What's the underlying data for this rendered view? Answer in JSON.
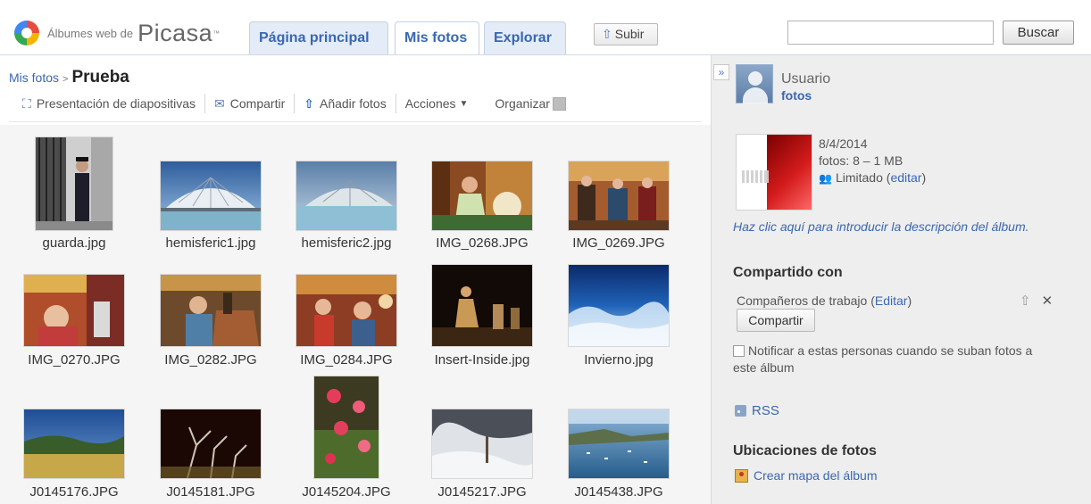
{
  "header": {
    "logo_sub": "Álbumes web de",
    "logo_main": "Picasa",
    "logo_tm": "™",
    "tabs": [
      {
        "label": "Página principal",
        "active": false
      },
      {
        "label": "Mis fotos",
        "active": true
      },
      {
        "label": "Explorar",
        "active": false
      }
    ],
    "upload_label": "Subir",
    "search_value": "",
    "search_button": "Buscar"
  },
  "breadcrumb": {
    "parent": "Mis fotos",
    "separator": ">",
    "current": "Prueba"
  },
  "toolbar": {
    "slideshow": "Presentación de diapositivas",
    "share": "Compartir",
    "add_photos": "Añadir fotos",
    "actions": "Acciones",
    "organize": "Organizar"
  },
  "photos": [
    {
      "name": "guarda.jpg"
    },
    {
      "name": "hemisferic1.jpg"
    },
    {
      "name": "hemisferic2.jpg"
    },
    {
      "name": "IMG_0268.JPG"
    },
    {
      "name": "IMG_0269.JPG"
    },
    {
      "name": "IMG_0270.JPG"
    },
    {
      "name": "IMG_0282.JPG"
    },
    {
      "name": "IMG_0284.JPG"
    },
    {
      "name": "Insert-Inside.jpg"
    },
    {
      "name": "Invierno.jpg"
    },
    {
      "name": "J0145176.JPG"
    },
    {
      "name": "J0145181.JPG"
    },
    {
      "name": "J0145204.JPG"
    },
    {
      "name": "J0145217.JPG"
    },
    {
      "name": "J0145438.JPG"
    }
  ],
  "sidebar": {
    "collapse_glyph": "»",
    "user_name": "Usuario",
    "user_sub": "fotos",
    "album_date": "8/4/2014",
    "album_count": "fotos: 8 – 1 MB",
    "access_label": "Limitado",
    "access_edit_open": "(",
    "access_edit": "editar",
    "access_edit_close": ")",
    "description_link": "Haz clic aquí para introducir la descripción del álbum.",
    "shared_title": "Compartido con",
    "shared_with": "Compañeros de trabajo",
    "shared_edit": "Editar",
    "share_button": "Compartir",
    "notify_text": "Notificar a estas personas cuando se suban fotos a este álbum",
    "rss": "RSS",
    "locations_title": "Ubicaciones de fotos",
    "map_link": "Crear mapa del álbum"
  },
  "colors": {
    "link": "#3a67b0",
    "tab_bg": "#e4ecf7",
    "sidebar_bg": "#eeeeee",
    "grid_bg": "#f5f5f5"
  }
}
